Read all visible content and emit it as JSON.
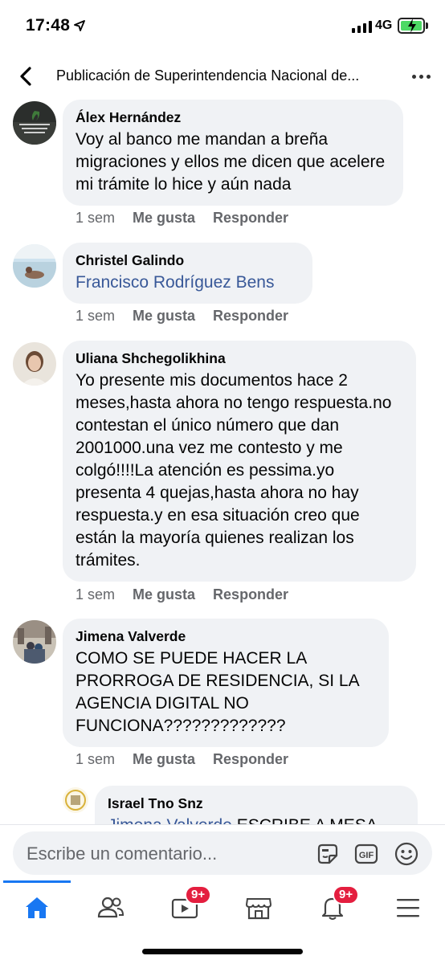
{
  "status_bar": {
    "time": "17:48",
    "network": "4G"
  },
  "header": {
    "title": "Publicación de Superintendencia Nacional de..."
  },
  "comments": [
    {
      "author": "Álex Hernández",
      "text": "Voy al banco me mandan a breña migraciones y ellos me dicen que acelere mi trámite lo hice y aún nada",
      "time": "1 sem",
      "like": "Me gusta",
      "reply": "Responder"
    },
    {
      "author": "Christel Galindo",
      "mention": "Francisco Rodríguez Bens",
      "time": "1 sem",
      "like": "Me gusta",
      "reply": "Responder"
    },
    {
      "author": "Uliana Shchegolikhina",
      "text": "Yo presente mis documentos hace 2 meses,hasta ahora no tengo respuesta.no contestan el único número que dan 2001000.una vez me contesto y me colgó!!!!La atención es pessima.yo presenta 4 quejas,hasta ahora no hay respuesta.y en esa situación  creo que están la mayoría quienes realizan los trámites.",
      "time": "1 sem",
      "like": "Me gusta",
      "reply": "Responder"
    },
    {
      "author": "Jimena Valverde",
      "text": "COMO SE PUEDE HACER LA PRORROGA DE RESIDENCIA, SI LA AGENCIA DIGITAL NO FUNCIONA?????????????",
      "time": "1 sem",
      "like": "Me gusta",
      "reply": "Responder"
    },
    {
      "author": "Israel Tno Snz",
      "mention": "Jimena Valverde",
      "text": "ESCRIBE A MESA"
    }
  ],
  "composer": {
    "placeholder": "Escribe un comentario..."
  },
  "tabbar": {
    "watch_badge": "9+",
    "notifications_badge": "9+"
  },
  "colors": {
    "accent": "#1877f2",
    "bubble": "#f0f2f5",
    "mention": "#385898",
    "badge": "#e41e3f",
    "muted": "#65676b"
  }
}
